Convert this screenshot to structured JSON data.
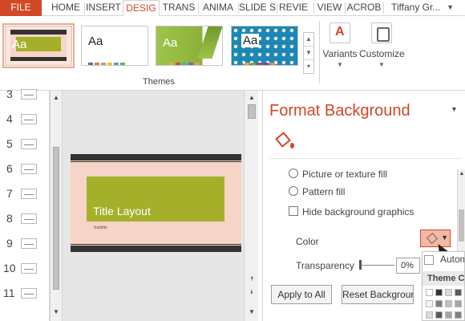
{
  "tabs": [
    {
      "label": "FILE",
      "active": false
    },
    {
      "label": "HOME",
      "active": false
    },
    {
      "label": "INSERT",
      "active": false
    },
    {
      "label": "DESIG",
      "active": true
    },
    {
      "label": "TRANS",
      "active": false
    },
    {
      "label": "ANIMA",
      "active": false
    },
    {
      "label": "SLIDE S",
      "active": false
    },
    {
      "label": "REVIE",
      "active": false
    },
    {
      "label": "VIEW",
      "active": false
    },
    {
      "label": "ACROB",
      "active": false
    }
  ],
  "user": {
    "name": "Tiffany Gr..."
  },
  "ribbon": {
    "themes_label": "Themes",
    "theme_thumbnails": [
      {
        "text": "Aa",
        "selected": true
      },
      {
        "text": "Aa",
        "selected": false
      },
      {
        "text": "Aa",
        "selected": false
      },
      {
        "text": "Aa",
        "selected": false
      }
    ],
    "variants_label": "Variants",
    "customize_label": "Customize"
  },
  "thumbnails": {
    "numbers": [
      "3",
      "4",
      "5",
      "6",
      "7",
      "8",
      "9",
      "10",
      "11"
    ]
  },
  "slide": {
    "title": "Title Layout",
    "subtitle": "Subtitle"
  },
  "format_background": {
    "title": "Format Background",
    "options": {
      "picture_fill": "Picture or texture fill",
      "pattern_fill": "Pattern fill",
      "hide_graphics": "Hide background graphics"
    },
    "color_label": "Color",
    "transparency_label": "Transparency",
    "transparency_value": "0%",
    "apply_all": "Apply to All",
    "reset_background": "Reset Background"
  },
  "color_menu": {
    "automatic": "Autom",
    "theme_colors_header": "Theme C"
  },
  "colors": {
    "accent": "#d24726",
    "theme_green": "#a5b02a",
    "slide_bg": "#f6d4c7"
  }
}
